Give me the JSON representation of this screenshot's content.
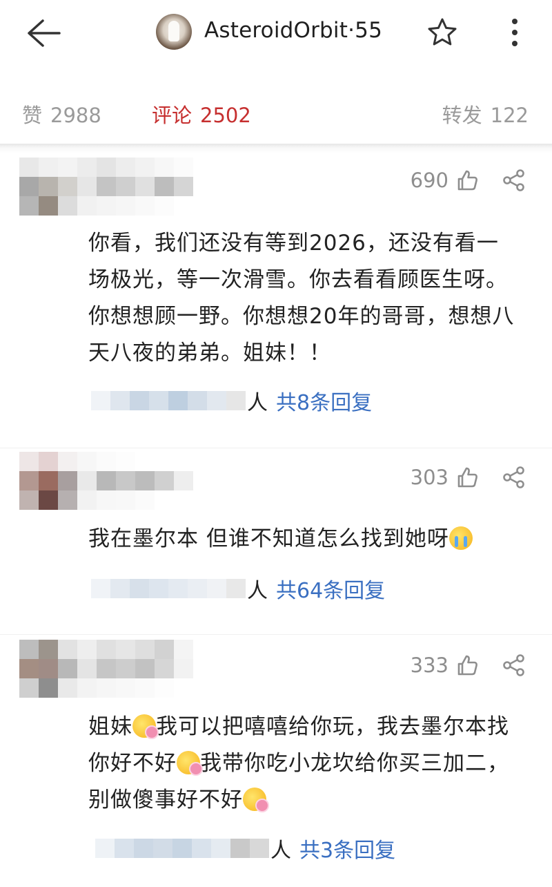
{
  "header": {
    "title": "AsteroidOrbit·55",
    "icons": [
      "back-arrow-icon",
      "star-icon",
      "more-vertical-icon"
    ]
  },
  "tabs": [
    {
      "label": "赞",
      "count": "2988",
      "active": false
    },
    {
      "label": "评论",
      "count": "2502",
      "active": true
    },
    {
      "label": "转发",
      "count": "122",
      "active": false
    }
  ],
  "colors": {
    "active_tab": "#c62f2f",
    "reply_link": "#3a6fc1",
    "muted": "#9a9a9a"
  },
  "comments": [
    {
      "likes": "690",
      "lines": [
        "你看，我们还没有等到2026，还没有看一",
        "场极光，等一次滑雪。你去看看顾医生呀。",
        "你想想顾一野。你想想20年的哥哥，想想八",
        "天八夜的弟弟。姐妹！！"
      ],
      "reply_suffix": "人",
      "reply_link": "共8条回复"
    },
    {
      "likes": "303",
      "text": "我在墨尔本 但谁不知道怎么找到她呀",
      "emoji": "loudly-crying-face-icon",
      "reply_suffix": "人",
      "reply_link": "共64条回复"
    },
    {
      "likes": "333",
      "segments": [
        "姐妹",
        "我可以把嘻嘻给你玩，我去墨尔本找",
        "你好不好",
        "我带你吃小龙坎给你买三加二，",
        "别做傻事好不好"
      ],
      "emoji": "face-holding-flower-icon",
      "reply_suffix": "人",
      "reply_link": "共3条回复"
    }
  ]
}
